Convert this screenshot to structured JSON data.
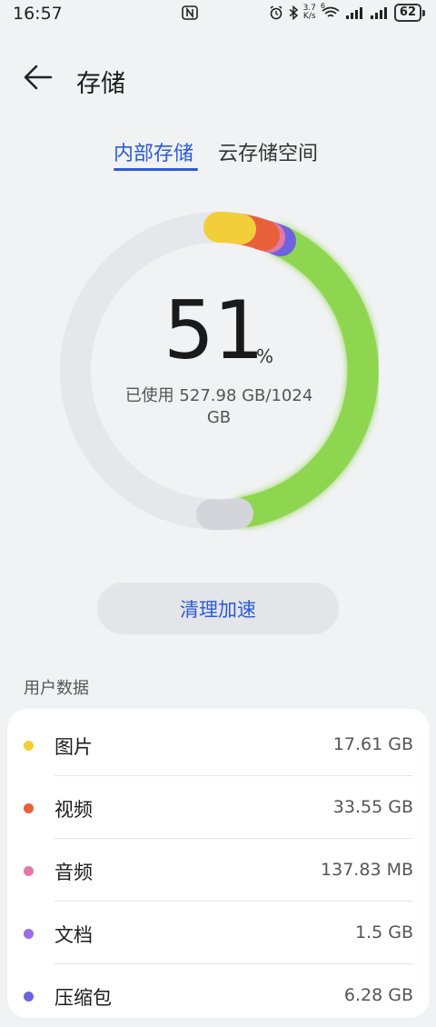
{
  "status_bar": {
    "time": "16:57",
    "speed_value": "3.7",
    "speed_unit": "K/s",
    "wifi_label": "6",
    "battery": "62"
  },
  "header": {
    "title": "存储"
  },
  "tabs": [
    {
      "label": "内部存储",
      "active": true
    },
    {
      "label": "云存储空间",
      "active": false
    }
  ],
  "usage": {
    "percent": "51",
    "percent_sign": "%",
    "used_text": "已使用 527.98 GB/1024 GB",
    "used_fraction": 0.51
  },
  "clean_button": {
    "label": "清理加速"
  },
  "user_data": {
    "title": "用户数据",
    "items": [
      {
        "label": "图片",
        "value": "17.61 GB",
        "color": "#f2cf3a"
      },
      {
        "label": "视频",
        "value": "33.55 GB",
        "color": "#e8603a"
      },
      {
        "label": "音频",
        "value": "137.83 MB",
        "color": "#e37aa5"
      },
      {
        "label": "文档",
        "value": "1.5 GB",
        "color": "#9b6be6"
      },
      {
        "label": "压缩包",
        "value": "6.28 GB",
        "color": "#6f62e0"
      }
    ]
  },
  "colors": {
    "accent": "#2a5bd7",
    "ring_green": "#8ed650",
    "ring_track": "#e6e7ea",
    "ring_system": "#d4d5da"
  }
}
